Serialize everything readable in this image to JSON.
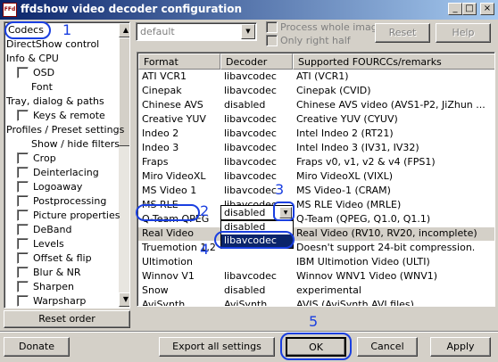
{
  "window": {
    "title": "ffdshow video decoder configuration",
    "icon_text": "FFd",
    "minimize": "_",
    "maximize": "□",
    "close": "×"
  },
  "tree": {
    "items": [
      {
        "label": "Codecs",
        "checkbox": false,
        "indent": 0,
        "selected": true
      },
      {
        "label": "DirectShow control",
        "checkbox": false,
        "indent": 0
      },
      {
        "label": "Info & CPU",
        "checkbox": false,
        "indent": 0
      },
      {
        "label": "OSD",
        "checkbox": true,
        "indent": 1
      },
      {
        "label": "Font",
        "checkbox": false,
        "indent": 2
      },
      {
        "label": "Tray, dialog & paths",
        "checkbox": false,
        "indent": 0
      },
      {
        "label": "Keys & remote",
        "checkbox": true,
        "indent": 1
      },
      {
        "label": "Profiles / Preset settings",
        "checkbox": false,
        "indent": 0
      },
      {
        "label": "Show / hide filters",
        "checkbox": false,
        "indent": 2
      },
      {
        "label": "Crop",
        "checkbox": true,
        "indent": 1
      },
      {
        "label": "Deinterlacing",
        "checkbox": true,
        "indent": 1
      },
      {
        "label": "Logoaway",
        "checkbox": true,
        "indent": 1
      },
      {
        "label": "Postprocessing",
        "checkbox": true,
        "indent": 1
      },
      {
        "label": "Picture properties",
        "checkbox": true,
        "indent": 1
      },
      {
        "label": "DeBand",
        "checkbox": true,
        "indent": 1
      },
      {
        "label": "Levels",
        "checkbox": true,
        "indent": 1
      },
      {
        "label": "Offset & flip",
        "checkbox": true,
        "indent": 1
      },
      {
        "label": "Blur & NR",
        "checkbox": true,
        "indent": 1
      },
      {
        "label": "Sharpen",
        "checkbox": true,
        "indent": 1
      },
      {
        "label": "Warpsharp",
        "checkbox": true,
        "indent": 1
      }
    ],
    "reset_order": "Reset order"
  },
  "preset": {
    "value": "default",
    "process_whole_image": "Process whole image",
    "only_right_half": "Only right half",
    "reset": "Reset",
    "help": "Help"
  },
  "grid": {
    "columns": [
      "Format",
      "Decoder",
      "Supported FOURCCs/remarks"
    ],
    "rows": [
      [
        "ATI VCR1",
        "libavcodec",
        "ATI (VCR1)"
      ],
      [
        "Cinepak",
        "libavcodec",
        "Cinepak (CVID)"
      ],
      [
        "Chinese AVS",
        "disabled",
        "Chinese AVS video (AVS1-P2, JiZhun ..."
      ],
      [
        "Creative YUV",
        "libavcodec",
        "Creative YUV (CYUV)"
      ],
      [
        "Indeo 2",
        "libavcodec",
        "Intel Indeo 2 (RT21)"
      ],
      [
        "Indeo 3",
        "libavcodec",
        "Intel Indeo 3 (IV31, IV32)"
      ],
      [
        "Fraps",
        "libavcodec",
        "Fraps v0, v1, v2 & v4 (FPS1)"
      ],
      [
        "Miro VideoXL",
        "libavcodec",
        "Miro VideoXL (VIXL)"
      ],
      [
        "MS Video 1",
        "libavcodec",
        "MS Video-1 (CRAM)"
      ],
      [
        "MS RLE",
        "libavcodec",
        "MS RLE Video (MRLE)"
      ],
      [
        "Q-Team QPEG",
        "libavcodec",
        "Q-Team (QPEG, Q1.0, Q1.1)"
      ],
      [
        "Real Video",
        "disabled",
        "Real Video (RV10, RV20, incomplete)"
      ],
      [
        "Truemotion 1,2",
        "",
        "Doesn't support 24-bit compression."
      ],
      [
        "Ultimotion",
        "",
        "IBM Ultimotion Video (ULTI)"
      ],
      [
        "Winnov V1",
        "libavcodec",
        "Winnov WNV1 Video (WNV1)"
      ],
      [
        "Snow",
        "disabled",
        "experimental"
      ],
      [
        "AviSynth",
        "AviSynth",
        "AVIS (AviSynth AVI files)"
      ]
    ],
    "selected_row": 11,
    "dropdown_options": [
      "disabled",
      "libavcodec"
    ],
    "dropdown_highlighted": 1
  },
  "annotations": [
    "1",
    "2",
    "3",
    "4",
    "5"
  ],
  "buttons": {
    "donate": "Donate",
    "export_all": "Export all settings",
    "ok": "OK",
    "cancel": "Cancel",
    "apply": "Apply"
  }
}
